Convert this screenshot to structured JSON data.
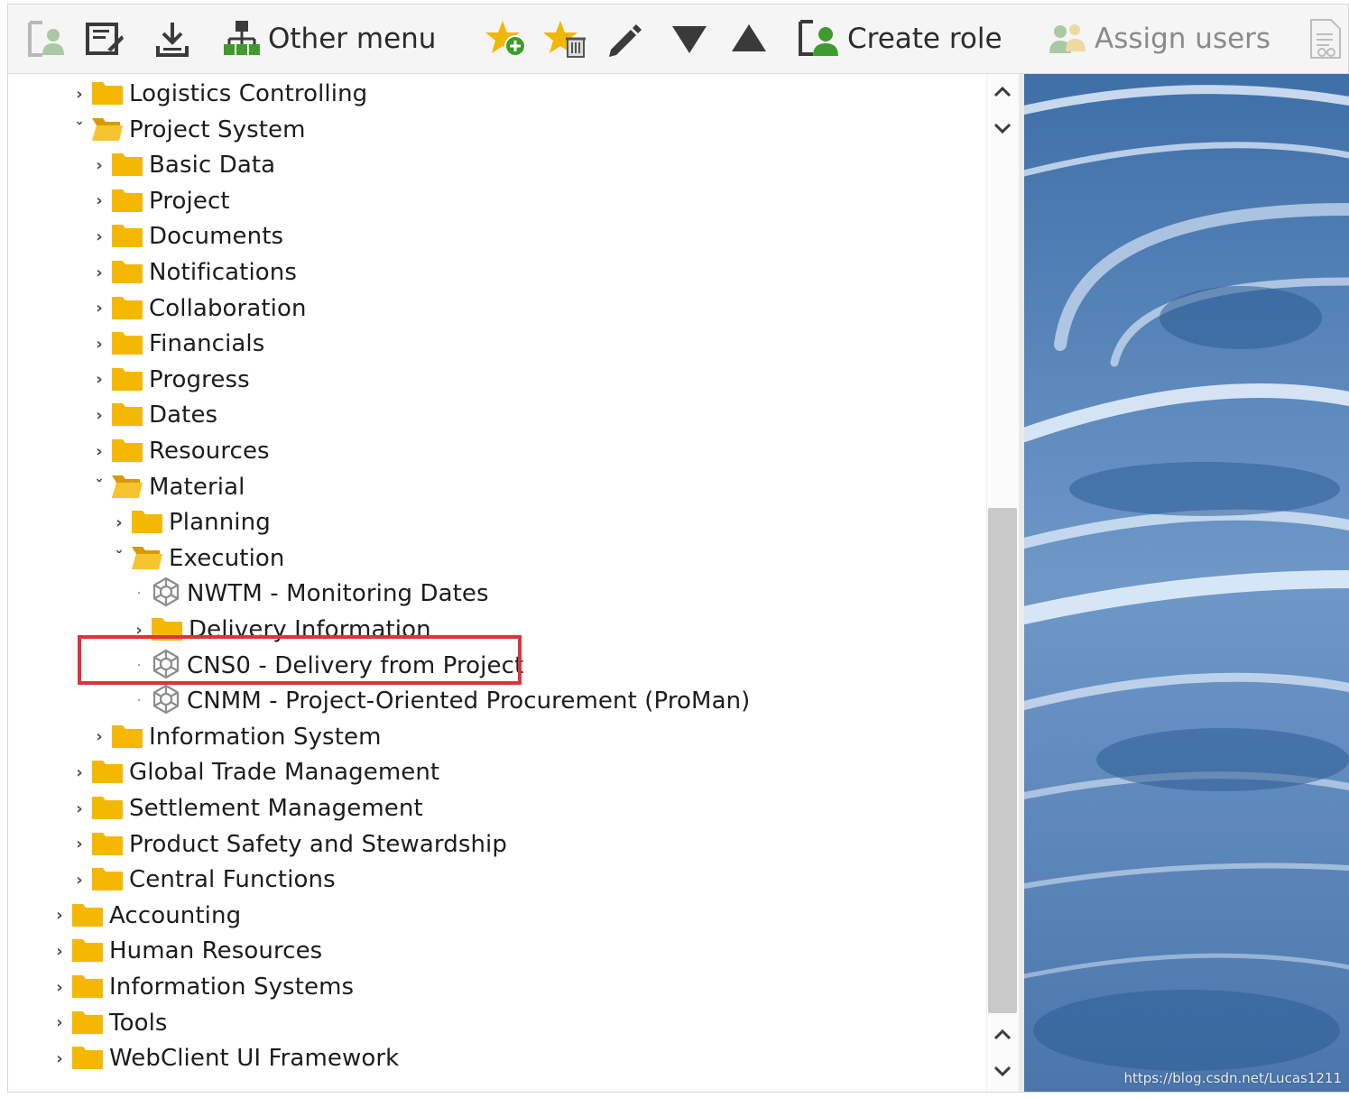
{
  "toolbar": {
    "other_menu": "Other menu",
    "create_role": "Create role",
    "assign_users": "Assign users"
  },
  "tree": [
    {
      "label": "Logistics Controlling",
      "type": "folder",
      "state": "collapsed"
    },
    {
      "label": "Project System",
      "type": "folder",
      "state": "expanded"
    },
    {
      "label": "Basic Data",
      "type": "folder",
      "state": "collapsed"
    },
    {
      "label": "Project",
      "type": "folder",
      "state": "collapsed"
    },
    {
      "label": "Documents",
      "type": "folder",
      "state": "collapsed"
    },
    {
      "label": "Notifications",
      "type": "folder",
      "state": "collapsed"
    },
    {
      "label": "Collaboration",
      "type": "folder",
      "state": "collapsed"
    },
    {
      "label": "Financials",
      "type": "folder",
      "state": "collapsed"
    },
    {
      "label": "Progress",
      "type": "folder",
      "state": "collapsed"
    },
    {
      "label": "Dates",
      "type": "folder",
      "state": "collapsed"
    },
    {
      "label": "Resources",
      "type": "folder",
      "state": "collapsed"
    },
    {
      "label": "Material",
      "type": "folder",
      "state": "expanded"
    },
    {
      "label": "Planning",
      "type": "folder",
      "state": "collapsed"
    },
    {
      "label": "Execution",
      "type": "folder",
      "state": "expanded"
    },
    {
      "label": "NWTM - Monitoring Dates",
      "type": "transaction",
      "state": "leaf"
    },
    {
      "label": "Delivery Information",
      "type": "folder",
      "state": "collapsed"
    },
    {
      "label": "CNS0 - Delivery from Project",
      "type": "transaction",
      "state": "leaf",
      "highlighted": true
    },
    {
      "label": "CNMM - Project-Oriented Procurement (ProMan)",
      "type": "transaction",
      "state": "leaf"
    },
    {
      "label": "Information System",
      "type": "folder",
      "state": "collapsed"
    },
    {
      "label": "Global Trade Management",
      "type": "folder",
      "state": "collapsed"
    },
    {
      "label": "Settlement Management",
      "type": "folder",
      "state": "collapsed"
    },
    {
      "label": "Product Safety and Stewardship",
      "type": "folder",
      "state": "collapsed"
    },
    {
      "label": "Central Functions",
      "type": "folder",
      "state": "collapsed"
    },
    {
      "label": "Accounting",
      "type": "folder",
      "state": "collapsed"
    },
    {
      "label": "Human Resources",
      "type": "folder",
      "state": "collapsed"
    },
    {
      "label": "Information Systems",
      "type": "folder",
      "state": "collapsed"
    },
    {
      "label": "Tools",
      "type": "folder",
      "state": "collapsed"
    },
    {
      "label": "WebClient UI Framework",
      "type": "folder",
      "state": "collapsed"
    }
  ],
  "watermark": "https://blog.csdn.net/Lucas1211",
  "colors": {
    "folder": "#f5b800",
    "highlight_border": "#d9353b",
    "accent_green": "#3f9a2f",
    "toolbar_bg": "#f5f5f5"
  },
  "icons": [
    "user-role-icon",
    "edit-document-icon",
    "download-icon",
    "hierarchy-icon",
    "add-favorite-icon",
    "delete-favorite-icon",
    "pencil-icon",
    "move-down-icon",
    "move-up-icon",
    "create-role-icon",
    "assign-users-icon",
    "document-icon",
    "folder-icon",
    "folder-open-icon",
    "transaction-icon"
  ]
}
